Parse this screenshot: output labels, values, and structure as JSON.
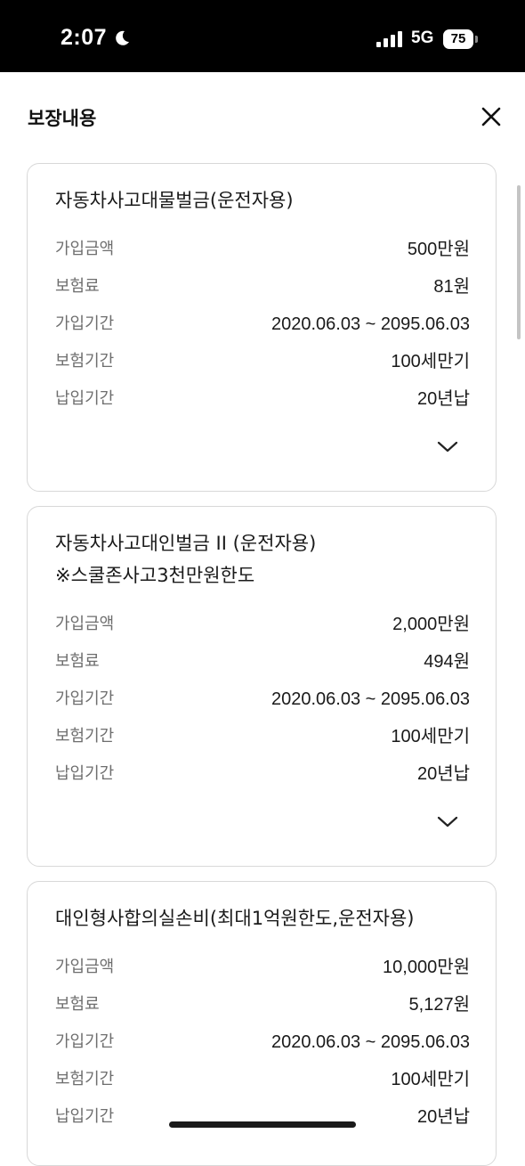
{
  "status_bar": {
    "time": "2:07",
    "network": "5G",
    "battery": "75"
  },
  "header": {
    "title": "보장내용"
  },
  "cards": [
    {
      "title_lines": [
        "자동차사고대물벌금(운전자용)"
      ],
      "rows": [
        {
          "label": "가입금액",
          "value": "500만원"
        },
        {
          "label": "보험료",
          "value": "81원"
        },
        {
          "label": "가입기간",
          "value": "2020.06.03 ~ 2095.06.03"
        },
        {
          "label": "보험기간",
          "value": "100세만기"
        },
        {
          "label": "납입기간",
          "value": "20년납"
        }
      ]
    },
    {
      "title_lines": [
        "자동차사고대인벌금 II (운전자용)",
        "※스쿨존사고3천만원한도"
      ],
      "rows": [
        {
          "label": "가입금액",
          "value": "2,000만원"
        },
        {
          "label": "보험료",
          "value": "494원"
        },
        {
          "label": "가입기간",
          "value": "2020.06.03 ~ 2095.06.03"
        },
        {
          "label": "보험기간",
          "value": "100세만기"
        },
        {
          "label": "납입기간",
          "value": "20년납"
        }
      ]
    },
    {
      "title_lines": [
        "대인형사합의실손비(최대1억원한도,운전자용)"
      ],
      "rows": [
        {
          "label": "가입금액",
          "value": "10,000만원"
        },
        {
          "label": "보험료",
          "value": "5,127원"
        },
        {
          "label": "가입기간",
          "value": "2020.06.03 ~ 2095.06.03"
        },
        {
          "label": "보험기간",
          "value": "100세만기"
        },
        {
          "label": "납입기간",
          "value": "20년납"
        }
      ]
    }
  ]
}
